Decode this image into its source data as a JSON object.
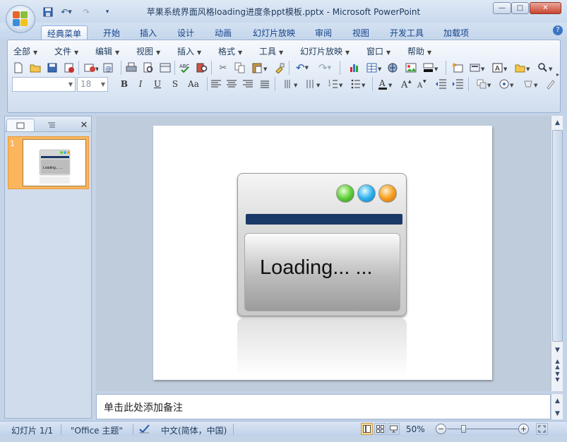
{
  "window": {
    "title": "苹果系统界面风格loading进度条ppt模板.pptx - Microsoft PowerPoint",
    "minimize": "—",
    "maximize": "□",
    "close": "✕"
  },
  "quick_access": {
    "save_icon": "save-icon",
    "undo_icon": "undo-icon",
    "redo_icon": "redo-icon"
  },
  "tabs": [
    {
      "label": "经典菜单",
      "active": true
    },
    {
      "label": "开始"
    },
    {
      "label": "插入"
    },
    {
      "label": "设计"
    },
    {
      "label": "动画"
    },
    {
      "label": "幻灯片放映"
    },
    {
      "label": "审阅"
    },
    {
      "label": "视图"
    },
    {
      "label": "开发工具"
    },
    {
      "label": "加载项"
    }
  ],
  "menus": [
    "全部",
    "文件",
    "编辑",
    "视图",
    "插入",
    "格式",
    "工具",
    "幻灯片放映",
    "窗口",
    "帮助"
  ],
  "toolbar": {
    "font_size": "18",
    "text_color_glyph": "A",
    "bold": "B",
    "italic": "I",
    "underline": "U",
    "shadow": "S",
    "case": "Aa"
  },
  "slide_panel": {
    "slide_number": "1",
    "thumb_text": "Loading... ..."
  },
  "slide": {
    "loading_text": "Loading... ...",
    "ball_colors": [
      "#5fd03a",
      "#2fb4ee",
      "#f7a11e"
    ],
    "bar_color": "#1b3966"
  },
  "notes": {
    "placeholder": "单击此处添加备注"
  },
  "status": {
    "slide_count": "幻灯片 1/1",
    "theme": "\"Office 主题\"",
    "language": "中文(简体，中国)",
    "zoom": "50%"
  }
}
